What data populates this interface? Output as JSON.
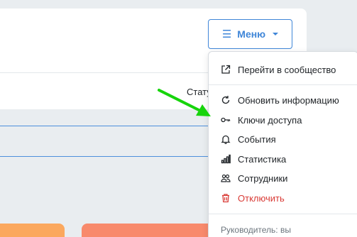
{
  "header": {
    "menu_button_label": "Меню",
    "status_label": "Стату"
  },
  "dropdown": {
    "items": [
      {
        "label": "Перейти в сообщество",
        "icon": "external-link-icon"
      },
      {
        "label": "Обновить информацию",
        "icon": "refresh-icon"
      },
      {
        "label": "Ключи доступа",
        "icon": "key-icon"
      },
      {
        "label": "События",
        "icon": "bell-icon"
      },
      {
        "label": "Статистика",
        "icon": "bar-chart-icon"
      },
      {
        "label": "Сотрудники",
        "icon": "people-icon"
      },
      {
        "label": "Отключить",
        "icon": "trash-icon"
      }
    ],
    "footer": "Руководитель: вы"
  },
  "colors": {
    "accent": "#3f86d8",
    "danger": "#d93a35",
    "annotation_arrow": "#17d40c",
    "tile_orange": "#fba85e",
    "tile_coral": "#f88a6c"
  }
}
